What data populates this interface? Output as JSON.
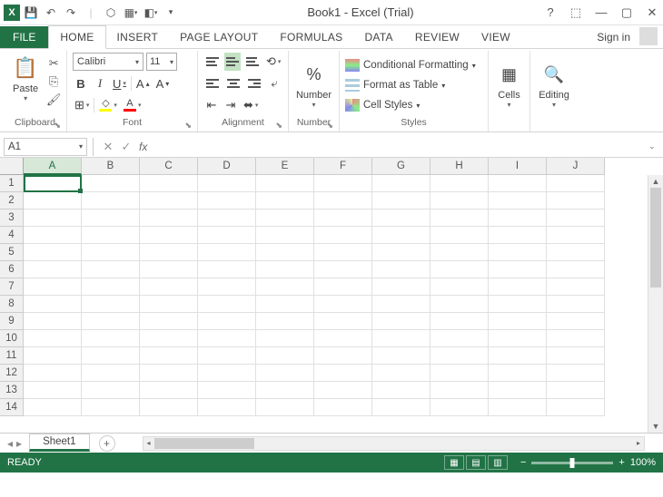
{
  "title": "Book1 - Excel (Trial)",
  "signin": "Sign in",
  "tabs": {
    "file": "FILE",
    "home": "HOME",
    "insert": "INSERT",
    "pagelayout": "PAGE LAYOUT",
    "formulas": "FORMULAS",
    "data": "DATA",
    "review": "REVIEW",
    "view": "VIEW"
  },
  "clipboard": {
    "paste": "Paste",
    "label": "Clipboard"
  },
  "font": {
    "name": "Calibri",
    "size": "11",
    "label": "Font"
  },
  "alignment": {
    "label": "Alignment"
  },
  "number": {
    "btn": "Number",
    "label": "Number"
  },
  "styles": {
    "cond": "Conditional Formatting",
    "table": "Format as Table",
    "cell": "Cell Styles",
    "label": "Styles"
  },
  "cells": {
    "btn": "Cells"
  },
  "editing": {
    "btn": "Editing"
  },
  "namebox": "A1",
  "fx": "fx",
  "columns": [
    "A",
    "B",
    "C",
    "D",
    "E",
    "F",
    "G",
    "H",
    "I",
    "J"
  ],
  "rows": [
    "1",
    "2",
    "3",
    "4",
    "5",
    "6",
    "7",
    "8",
    "9",
    "10",
    "11",
    "12",
    "13",
    "14"
  ],
  "sheet": "Sheet1",
  "status": "READY",
  "zoom": "100%",
  "pct": "%"
}
